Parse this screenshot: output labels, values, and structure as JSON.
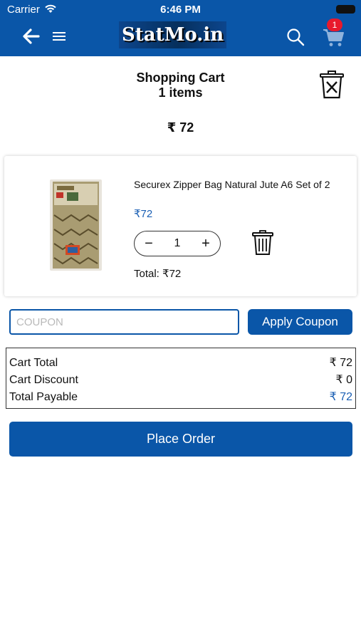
{
  "status_bar": {
    "carrier": "Carrier",
    "time": "6:46 PM"
  },
  "header": {
    "logo": "StatMo.in",
    "cart_count": "1"
  },
  "cart": {
    "title": "Shopping Cart",
    "items_count": "1 items",
    "amount": "₹ 72"
  },
  "item": {
    "name": "Securex Zipper Bag Natural Jute A6 Set of 2",
    "price": "₹72",
    "quantity": "1",
    "minus": "−",
    "plus": "+",
    "total": "Total: ₹72"
  },
  "coupon": {
    "placeholder": "COUPON",
    "value": "",
    "button_label": "Apply Coupon"
  },
  "summary": {
    "rows": [
      {
        "label": "Cart Total",
        "value": "₹ 72"
      },
      {
        "label": "Cart Discount",
        "value": "₹ 0"
      },
      {
        "label": "Total Payable",
        "value": "₹ 72"
      }
    ]
  },
  "place_order_label": "Place Order",
  "colors": {
    "primary": "#0a56a8",
    "price": "#1a5fb4",
    "badge": "#e8192c"
  },
  "icons": [
    "wifi-icon",
    "battery-icon",
    "back-arrow-icon",
    "hamburger-menu-icon",
    "search-icon",
    "cart-icon",
    "clear-cart-icon",
    "trash-icon"
  ]
}
